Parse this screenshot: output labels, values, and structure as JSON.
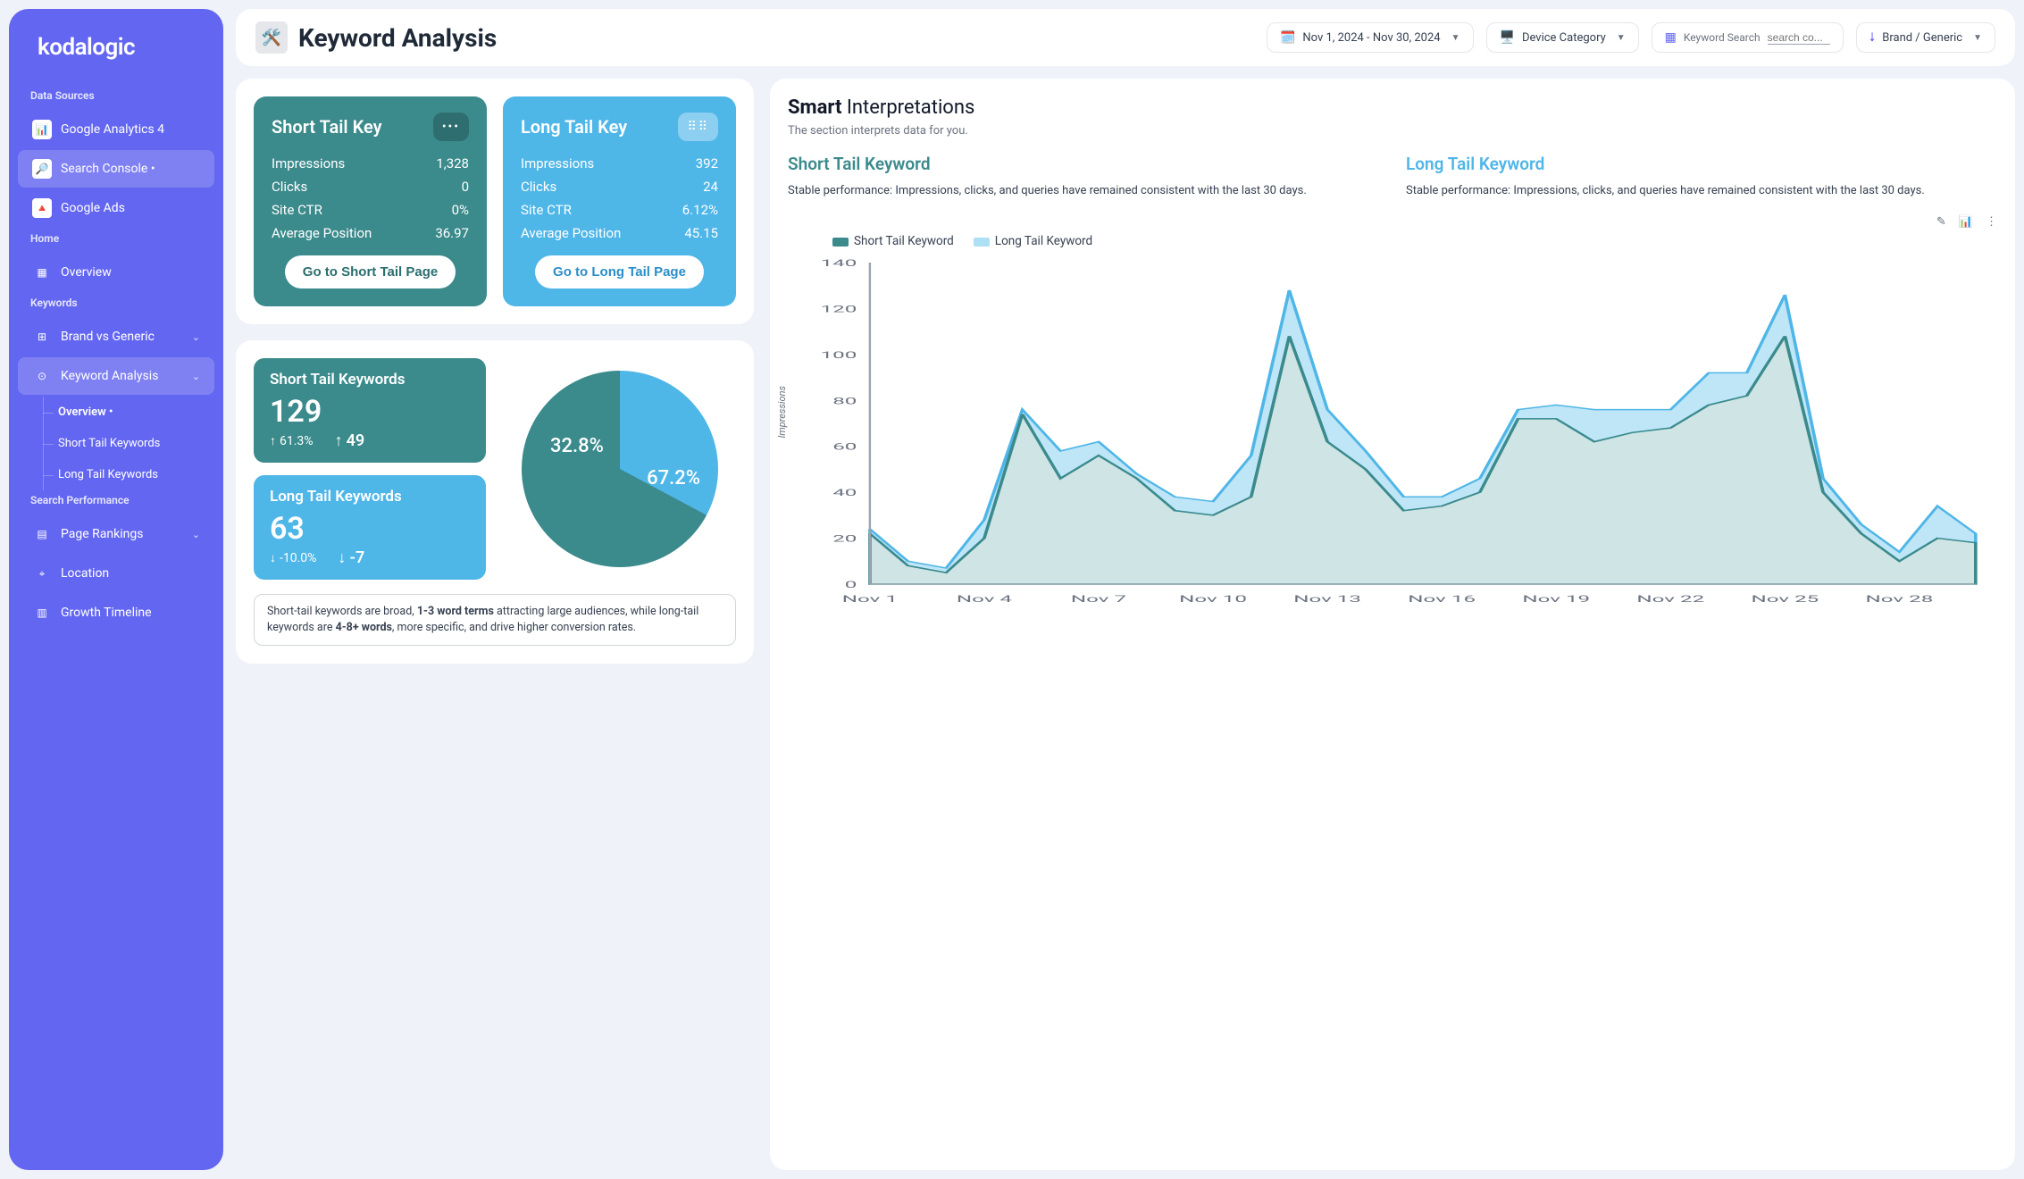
{
  "app": {
    "name": "kodalogic"
  },
  "sidebar": {
    "sec_data": "Data Sources",
    "sec_home": "Home",
    "sec_keywords": "Keywords",
    "sec_search": "Search Performance",
    "ga4": "Google Analytics 4",
    "sc": "Search Console •",
    "gads": "Google Ads",
    "overview": "Overview",
    "brand": "Brand vs Generic",
    "kw": "Keyword Analysis",
    "sub_overview": "Overview •",
    "sub_short": "Short Tail Keywords",
    "sub_long": "Long Tail Keywords",
    "rankings": "Page Rankings",
    "location": "Location",
    "growth": "Growth Timeline"
  },
  "header": {
    "title": "Keyword Analysis",
    "date_range": "Nov 1, 2024 - Nov 30, 2024",
    "device_label": "Device Category",
    "kw_label": "Keyword Search",
    "kw_placeholder": "search co...",
    "brand_label": "Brand / Generic"
  },
  "short_card": {
    "title": "Short Tail Key",
    "m1_l": "Impressions",
    "m1_v": "1,328",
    "m2_l": "Clicks",
    "m2_v": "0",
    "m3_l": "Site CTR",
    "m3_v": "0%",
    "m4_l": "Average Position",
    "m4_v": "36.97",
    "btn": "Go to Short Tail Page"
  },
  "long_card": {
    "title": "Long Tail Key",
    "m1_l": "Impressions",
    "m1_v": "392",
    "m2_l": "Clicks",
    "m2_v": "24",
    "m3_l": "Site CTR",
    "m3_v": "6.12%",
    "m4_l": "Average Position",
    "m4_v": "45.15",
    "btn": "Go to Long Tail Page"
  },
  "stat_short": {
    "title": "Short Tail Keywords",
    "big": "129",
    "pct": "61.3%",
    "delta": "49"
  },
  "stat_long": {
    "title": "Long Tail Keywords",
    "big": "63",
    "pct": "-10.0%",
    "delta": "-7"
  },
  "donut": {
    "l1": "32.8%",
    "l2": "67.2%"
  },
  "note": {
    "t1": "Short-tail keywords are broad, ",
    "b1": "1-3 word terms",
    "t2": " attracting large audiences, while long-tail keywords are ",
    "b2": "4-8+ words",
    "t3": ", more specific, and drive higher conversion rates."
  },
  "smart": {
    "head_b": "Smart",
    "head_r": " Interpretations",
    "sub": "The section interprets data for you.",
    "short_title": "Short Tail Keyword",
    "long_title": "Long Tail Keyword",
    "short_body": "Stable performance: Impressions, clicks, and queries have remained consistent with the last 30 days.",
    "long_body": "Stable performance: Impressions, clicks, and queries have remained consistent with the last 30 days."
  },
  "chart": {
    "ylabel": "Impressions",
    "leg_short": "Short Tail Keyword",
    "leg_long": "Long Tail Keyword"
  },
  "chart_data": {
    "type": "area",
    "ylabel": "Impressions",
    "ylim": [
      0,
      140
    ],
    "yticks": [
      0,
      20,
      40,
      60,
      80,
      100,
      120,
      140
    ],
    "xticks": [
      "Nov 1",
      "Nov 4",
      "Nov 7",
      "Nov 10",
      "Nov 13",
      "Nov 16",
      "Nov 19",
      "Nov 22",
      "Nov 25",
      "Nov 28"
    ],
    "categories": [
      "Nov 1",
      "Nov 2",
      "Nov 3",
      "Nov 4",
      "Nov 5",
      "Nov 6",
      "Nov 7",
      "Nov 8",
      "Nov 9",
      "Nov 10",
      "Nov 11",
      "Nov 12",
      "Nov 13",
      "Nov 14",
      "Nov 15",
      "Nov 16",
      "Nov 17",
      "Nov 18",
      "Nov 19",
      "Nov 20",
      "Nov 21",
      "Nov 22",
      "Nov 23",
      "Nov 24",
      "Nov 25",
      "Nov 26",
      "Nov 27",
      "Nov 28",
      "Nov 29",
      "Nov 30"
    ],
    "series": [
      {
        "name": "Short Tail Keyword",
        "color": "#3b8a8c",
        "values": [
          22,
          8,
          5,
          20,
          74,
          46,
          56,
          46,
          32,
          30,
          38,
          108,
          62,
          50,
          32,
          34,
          40,
          72,
          72,
          62,
          66,
          68,
          78,
          82,
          108,
          40,
          22,
          10,
          20,
          18
        ]
      },
      {
        "name": "Long Tail Keyword",
        "color": "#aee0f4",
        "values": [
          2,
          2,
          2,
          8,
          2,
          12,
          6,
          2,
          6,
          6,
          18,
          20,
          14,
          8,
          6,
          4,
          6,
          4,
          6,
          14,
          10,
          8,
          14,
          10,
          18,
          6,
          4,
          4,
          14,
          4
        ]
      }
    ]
  }
}
